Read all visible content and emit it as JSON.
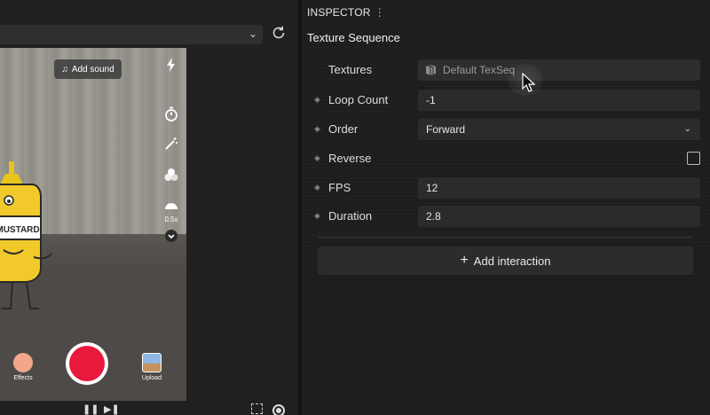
{
  "preview": {
    "add_sound_label": "Add sound",
    "speed_label": "0.5x",
    "mustard_label": "MUSTARD",
    "effects_label": "Effects",
    "upload_label": "Upload",
    "icons": [
      "flash-icon",
      "timer-icon",
      "magic-wand-icon",
      "color-filter-icon",
      "speed-icon",
      "chevron-down-icon"
    ],
    "record_color": "#e8193c"
  },
  "inspector": {
    "header": "INSPECTOR",
    "header_menu": "⋮",
    "section_title": "Texture Sequence",
    "rows": {
      "textures": {
        "label": "Textures",
        "value": "Default TexSeq"
      },
      "loop_count": {
        "label": "Loop Count",
        "value": "-1"
      },
      "order": {
        "label": "Order",
        "value": "Forward"
      },
      "reverse": {
        "label": "Reverse",
        "checked": false
      },
      "fps": {
        "label": "FPS",
        "value": "12"
      },
      "duration": {
        "label": "Duration",
        "value": "2.8"
      }
    },
    "add_interaction_label": "Add interaction"
  }
}
